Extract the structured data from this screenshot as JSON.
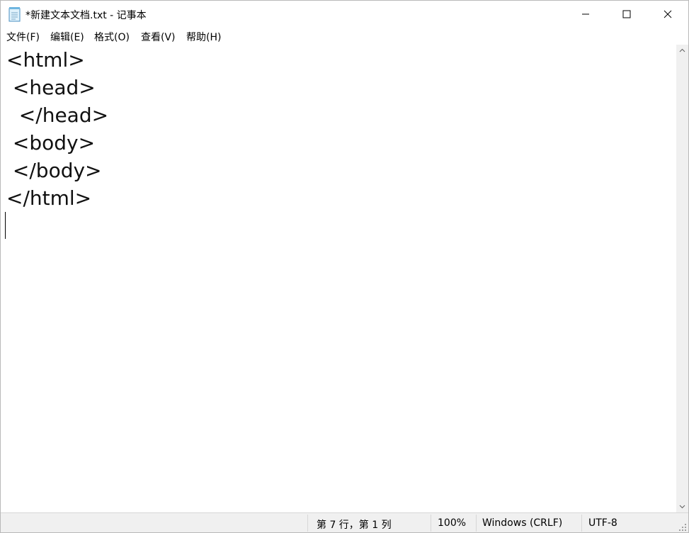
{
  "titlebar": {
    "title": "*新建文本文档.txt - 记事本",
    "app_icon": "notepad-icon"
  },
  "window_controls": {
    "minimize": "minimize-icon",
    "maximize": "maximize-icon",
    "close": "close-icon"
  },
  "menubar": {
    "items": [
      {
        "label": "文件(F)"
      },
      {
        "label": "编辑(E)"
      },
      {
        "label": "格式(O)"
      },
      {
        "label": "查看(V)"
      },
      {
        "label": "帮助(H)"
      }
    ]
  },
  "editor": {
    "lines": [
      "<html>",
      " <head>",
      "  </head>",
      " <body>",
      " </body>",
      "</html>",
      ""
    ]
  },
  "statusbar": {
    "position": "第 7 行，第 1 列",
    "zoom": "100%",
    "line_ending": "Windows (CRLF)",
    "encoding": "UTF-8"
  },
  "colors": {
    "background": "#ffffff",
    "statusbar": "#f0f0f0",
    "scrollbar": "#f0f0f0"
  }
}
